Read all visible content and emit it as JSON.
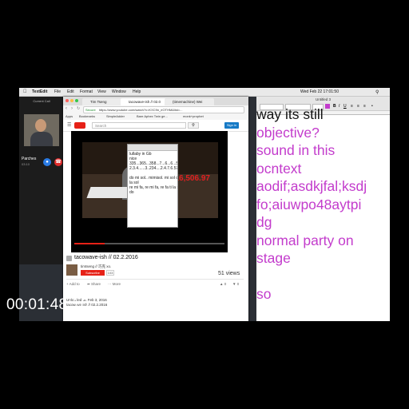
{
  "menubar": {
    "app": "TextEdit",
    "items": [
      "File",
      "Edit",
      "Format",
      "View",
      "Window",
      "Help"
    ],
    "clock": "Wed Feb 22  17:01:50",
    "doc_title": "Untitled 3"
  },
  "call": {
    "header": "Current Call",
    "name": "Parches",
    "duration": "03:10"
  },
  "browser": {
    "tabs": [
      "Tim Tseng",
      "tacowave-ish // 02.0",
      "(timemachine) Wei"
    ],
    "secure": "Secure",
    "url": "https://www.youtube.com/watch?v=KXC9n_eOTHM&list=...",
    "bookmarks": [
      "Apps",
      "Bookmarks",
      "SimpleAdder",
      "Bare Aphex Twin ge...",
      "monk+prophet"
    ],
    "search_placeholder": "Search",
    "sign_in": "Sign in",
    "overlay_text": "$7,016,506.97",
    "video_title": "tacowave-ish // 02.2.2016",
    "channel": "timtseng // 巧克 xo.",
    "subscribe": "Subscribe",
    "sub_count": "103",
    "views": "51 views",
    "add_to": "Add to",
    "share": "Share",
    "more": "More",
    "likes": "0",
    "dislikes": "0",
    "published": "Uploaded on Feb 3, 2016",
    "desc": "tacowave-ish // 02.2.2016"
  },
  "notes": {
    "lines": [
      "lullaby in Gb",
      "nice",
      "335...365...358...7...6...6...5...",
      "2.3.4......3..234....2.4.7.6.57..8",
      "",
      "do mi sol.. mimisol. mi sol do ti la",
      "la sol",
      "re mi fa, re mi fa, re fa ti la sol ti",
      "do"
    ]
  },
  "textedit": {
    "lines": [
      "way its still",
      "objective?",
      "sound in this",
      "ocntext",
      "aodif;asdkjfal;ksdj",
      "fo;aiuwpo48aytpi",
      "dg",
      "normal party on",
      "stage",
      "",
      "so"
    ]
  },
  "timecode": "00:01:48;10",
  "colors": {
    "textedit_text": "#c33ccc",
    "youtube_red": "#e62117",
    "overlay_red": "#e02020"
  }
}
